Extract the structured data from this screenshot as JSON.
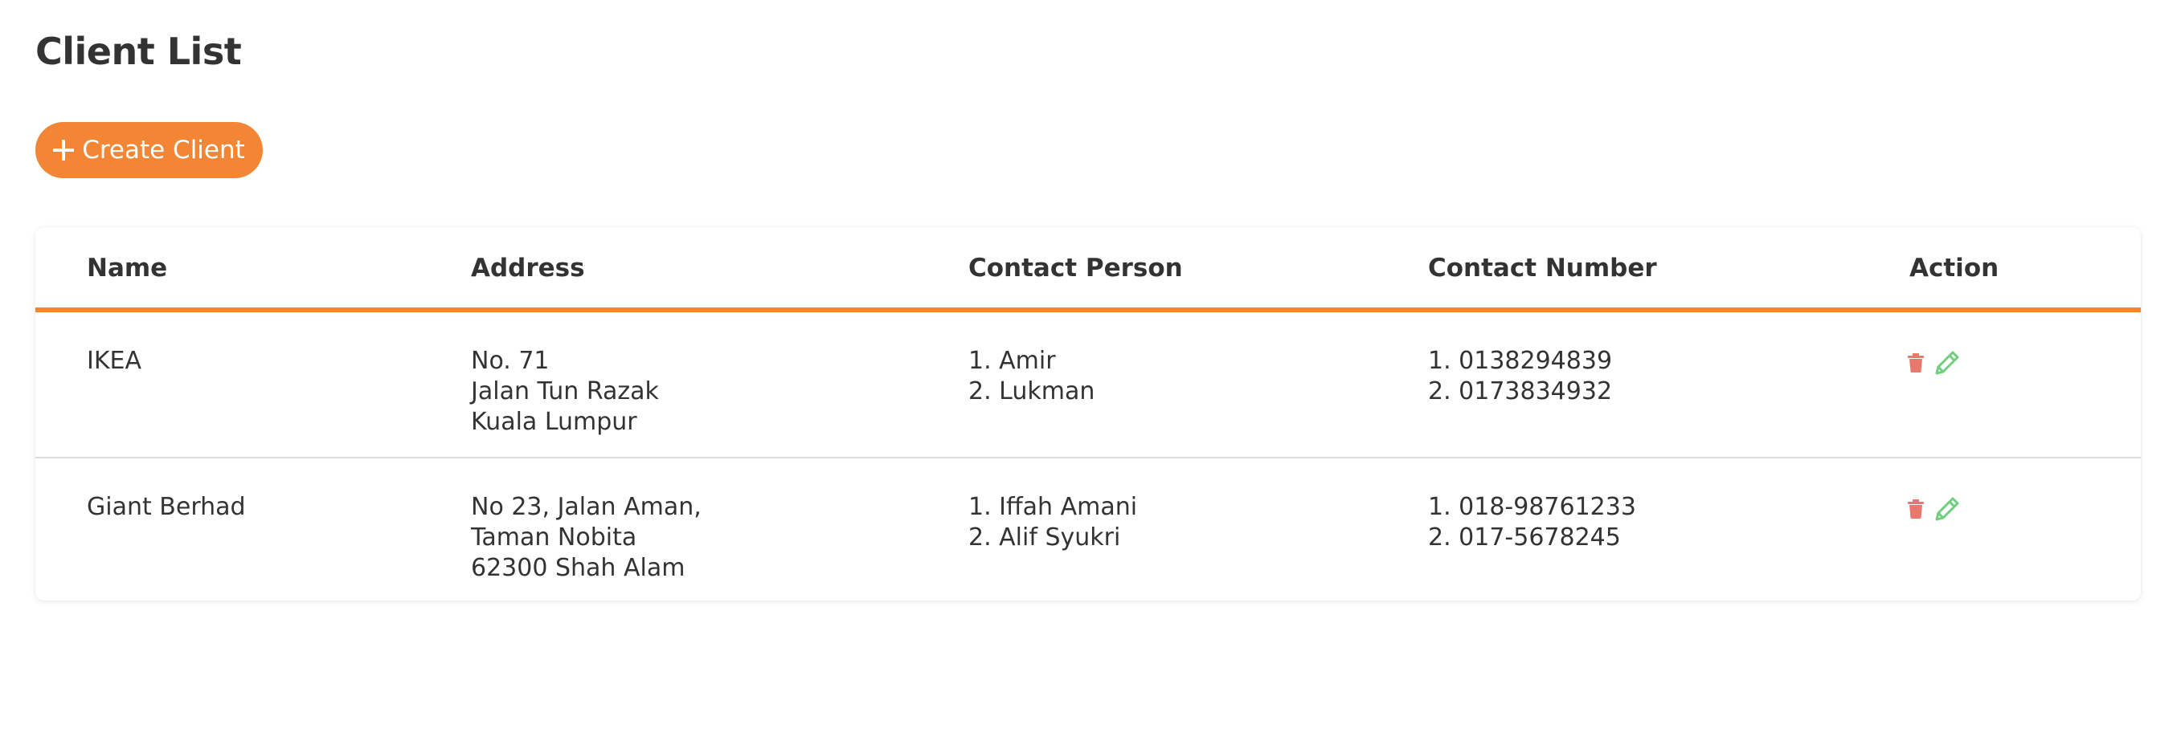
{
  "page": {
    "title": "Client List"
  },
  "toolbar": {
    "create_label": "Create Client",
    "create_icon": "plus-icon"
  },
  "colors": {
    "accent": "#f28634",
    "delete": "#e8786c",
    "edit": "#6fcf7e",
    "text": "#333333"
  },
  "table": {
    "headers": {
      "name": "Name",
      "address": "Address",
      "contact_person": "Contact Person",
      "contact_number": "Contact Number",
      "action": "Action"
    },
    "rows": [
      {
        "name": "IKEA",
        "address": [
          "No. 71",
          "Jalan Tun Razak",
          "Kuala Lumpur"
        ],
        "contact_person": [
          "1. Amir",
          "2. Lukman"
        ],
        "contact_number": [
          "1. 0138294839",
          "2. 0173834932"
        ],
        "actions": [
          "trash-icon",
          "pencil-icon"
        ]
      },
      {
        "name": "Giant Berhad",
        "address": [
          "No 23, Jalan Aman,",
          "Taman Nobita",
          "62300 Shah Alam"
        ],
        "contact_person": [
          "1. Iffah Amani",
          "2. Alif Syukri"
        ],
        "contact_number": [
          "1. 018-98761233",
          "2. 017-5678245"
        ],
        "actions": [
          "trash-icon",
          "pencil-icon"
        ]
      }
    ]
  }
}
